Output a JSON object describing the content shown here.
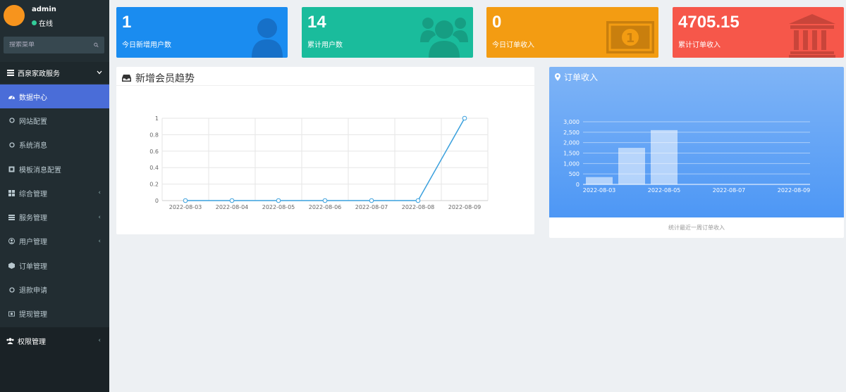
{
  "user": {
    "name": "admin",
    "status": "在线"
  },
  "search": {
    "placeholder": "搜索菜单"
  },
  "sidebar": {
    "header": "西泉家政服务",
    "items": [
      {
        "label": "数据中心",
        "icon": "dashboard-icon",
        "active": true,
        "has_children": false
      },
      {
        "label": "网站配置",
        "icon": "circle-icon",
        "active": false,
        "has_children": false
      },
      {
        "label": "系统消息",
        "icon": "circle-icon",
        "active": false,
        "has_children": false
      },
      {
        "label": "模板消息配置",
        "icon": "square-icon",
        "active": false,
        "has_children": false
      },
      {
        "label": "综合管理",
        "icon": "grid-icon",
        "active": false,
        "has_children": true
      },
      {
        "label": "服务管理",
        "icon": "list-icon",
        "active": false,
        "has_children": true
      },
      {
        "label": "用户管理",
        "icon": "user-circle-icon",
        "active": false,
        "has_children": true
      },
      {
        "label": "订单管理",
        "icon": "cube-icon",
        "active": false,
        "has_children": false
      },
      {
        "label": "退款申请",
        "icon": "circle-icon",
        "active": false,
        "has_children": false
      },
      {
        "label": "提现管理",
        "icon": "money-icon",
        "active": false,
        "has_children": false
      }
    ],
    "bottom_item": {
      "label": "权限管理",
      "icon": "users-icon"
    }
  },
  "stats": [
    {
      "value": "1",
      "label": "今日新增用户数",
      "color": "#1a8cf0",
      "icon": "user-icon"
    },
    {
      "value": "14",
      "label": "累计用户数",
      "color": "#1abc9c",
      "icon": "users-icon"
    },
    {
      "value": "0",
      "label": "今日订单收入",
      "color": "#f39c12",
      "icon": "money-icon"
    },
    {
      "value": "4705.15",
      "label": "累计订单收入",
      "color": "#f6574a",
      "icon": "bank-icon"
    }
  ],
  "left_panel": {
    "title": "新增会员趋势"
  },
  "right_panel": {
    "title": "订单收入",
    "footer": "统计最近一周订单收入"
  },
  "chart_data": [
    {
      "type": "line",
      "categories": [
        "2022-08-03",
        "2022-08-04",
        "2022-08-05",
        "2022-08-06",
        "2022-08-07",
        "2022-08-08",
        "2022-08-09"
      ],
      "values": [
        0,
        0,
        0,
        0,
        0,
        0,
        1
      ],
      "ylim": [
        0,
        1
      ],
      "yticks": [
        "0",
        "0.2",
        "0.4",
        "0.6",
        "0.8",
        "1"
      ],
      "grid": true,
      "color": "#3aa0dd"
    },
    {
      "type": "bar",
      "categories": [
        "2022-08-03",
        "2022-08-04",
        "2022-08-05",
        "2022-08-06",
        "2022-08-07",
        "2022-08-08",
        "2022-08-09"
      ],
      "xtick_labels": [
        "2022-08-03",
        "",
        "2022-08-05",
        "",
        "2022-08-07",
        "",
        "2022-08-09"
      ],
      "values": [
        350,
        1750,
        2600,
        0,
        0,
        0,
        0
      ],
      "ylim": [
        0,
        3000
      ],
      "yticks": [
        "0",
        "500",
        "1,000",
        "1,500",
        "2,000",
        "2,500",
        "3,000"
      ],
      "grid": true
    }
  ]
}
